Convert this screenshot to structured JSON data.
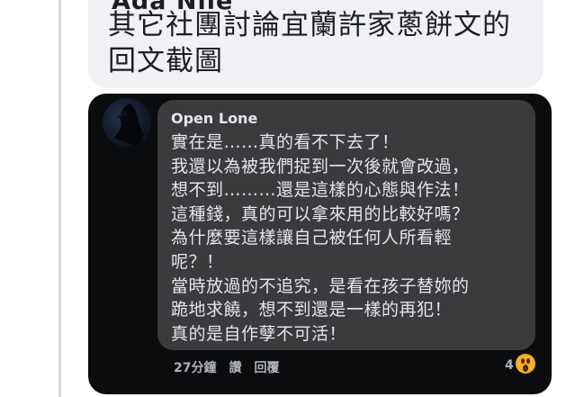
{
  "top_comment": {
    "author": "Ada Nile",
    "text": "其它社團討論宜蘭許家蔥餅文的回文截圖"
  },
  "comment": {
    "author": "Open Lone",
    "lines": [
      "實在是……真的看不下去了！",
      "我還以為被我們捉到一次後就會改過，",
      "想不到………還是這樣的心態與作法！",
      "這種錢，真的可以拿來用的比較好嗎？",
      "為什麼要這樣讓自己被任何人所看輕",
      "呢？！",
      "當時放過的不追究，是看在孩子替妳的",
      "跪地求饒，想不到還是一樣的再犯！",
      "真的是自作孽不可活！"
    ],
    "time": "27分鐘",
    "like_label": "讚",
    "reply_label": "回覆",
    "reaction_count": "4",
    "reaction_icon": "wow-reaction-icon"
  }
}
